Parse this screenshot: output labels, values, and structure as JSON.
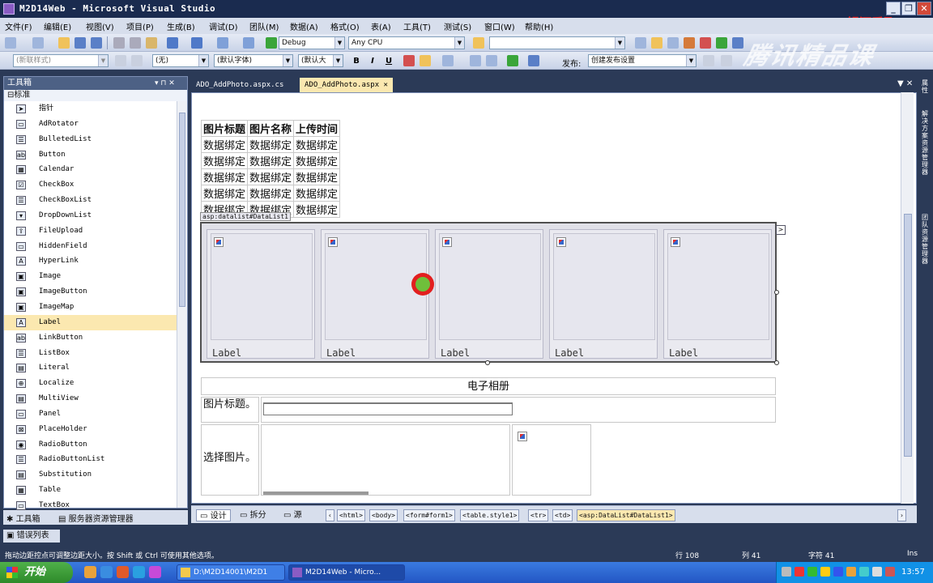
{
  "window": {
    "title": "M2D14Web - Microsoft Visual Studio",
    "brand": "银河爱飞",
    "watermark": "腾讯精品课"
  },
  "menu": [
    "文件(F)",
    "编辑(E)",
    "视图(V)",
    "项目(P)",
    "生成(B)",
    "调试(D)",
    "团队(M)",
    "数据(A)",
    "格式(O)",
    "表(A)",
    "工具(T)",
    "测试(S)",
    "窗口(W)",
    "帮助(H)"
  ],
  "toolbar1": {
    "config": "Debug",
    "platform": "Any CPU"
  },
  "toolbar2": {
    "css_style": "(新联样式)",
    "block_format": "(无)",
    "font_name": "(默认字体)",
    "font_size": "(默认大",
    "publish_label": "发布:",
    "publish_setting": "创建发布设置",
    "bold": "B",
    "italic": "I",
    "underline": "U"
  },
  "toolbox": {
    "header": "工具箱",
    "header_controls": "▾ ⊓ ✕",
    "group": "⊟标准",
    "items": [
      {
        "label": "指针",
        "icon": "➤"
      },
      {
        "label": "AdRotator",
        "icon": "▭"
      },
      {
        "label": "BulletedList",
        "icon": "☰"
      },
      {
        "label": "Button",
        "icon": "ab"
      },
      {
        "label": "Calendar",
        "icon": "▦"
      },
      {
        "label": "CheckBox",
        "icon": "☑"
      },
      {
        "label": "CheckBoxList",
        "icon": "☰"
      },
      {
        "label": "DropDownList",
        "icon": "▾"
      },
      {
        "label": "FileUpload",
        "icon": "⇪"
      },
      {
        "label": "HiddenField",
        "icon": "▭"
      },
      {
        "label": "HyperLink",
        "icon": "A"
      },
      {
        "label": "Image",
        "icon": "▣"
      },
      {
        "label": "ImageButton",
        "icon": "▣"
      },
      {
        "label": "ImageMap",
        "icon": "▣"
      },
      {
        "label": "Label",
        "icon": "A"
      },
      {
        "label": "LinkButton",
        "icon": "ab"
      },
      {
        "label": "ListBox",
        "icon": "☰"
      },
      {
        "label": "Literal",
        "icon": "▤"
      },
      {
        "label": "Localize",
        "icon": "⊕"
      },
      {
        "label": "MultiView",
        "icon": "▤"
      },
      {
        "label": "Panel",
        "icon": "▭"
      },
      {
        "label": "PlaceHolder",
        "icon": "⊠"
      },
      {
        "label": "RadioButton",
        "icon": "◉"
      },
      {
        "label": "RadioButtonList",
        "icon": "☰"
      },
      {
        "label": "Substitution",
        "icon": "▤"
      },
      {
        "label": "Table",
        "icon": "▦"
      },
      {
        "label": "TextBox",
        "icon": "▭"
      }
    ],
    "selected": "Label"
  },
  "bottom_tabs": {
    "toolbox": "工具箱",
    "server_explorer": "服务器资源管理器",
    "error_list": "错误列表"
  },
  "doc_tabs": [
    {
      "label": "ADO_AddPhoto.aspx.cs",
      "active": false
    },
    {
      "label": "ADO_AddPhoto.aspx",
      "active": true
    }
  ],
  "gridview": {
    "headers": [
      "图片标题",
      "图片名称",
      "上传时间"
    ],
    "rows": [
      [
        "数据绑定",
        "数据绑定",
        "数据绑定"
      ],
      [
        "数据绑定",
        "数据绑定",
        "数据绑定"
      ],
      [
        "数据绑定",
        "数据绑定",
        "数据绑定"
      ],
      [
        "数据绑定",
        "数据绑定",
        "数据绑定"
      ],
      [
        "数据绑定",
        "数据绑定",
        "数据绑定"
      ]
    ]
  },
  "datalist": {
    "badge": "asp:datalist#DataList1",
    "items": [
      "Label",
      "Label",
      "Label",
      "Label",
      "Label"
    ],
    "smart_tag": ">"
  },
  "album": {
    "caption": "电子相册",
    "title_label": "图片标题。",
    "choose_label": "选择图片。"
  },
  "view_bar": {
    "design": "设计",
    "split": "拆分",
    "source": "源",
    "crumbs": [
      "<html>",
      "<body>",
      "<form#form1>",
      "<table.style1>",
      "<tr>",
      "<td>",
      "<asp:DataList#DataList1>"
    ]
  },
  "right_dock": [
    "属性",
    "解决方案资源管理器",
    "团队资源管理器"
  ],
  "status": {
    "message": "拖动边距控点可调整边距大小。按 Shift 或 Ctrl 可使用其他选项。",
    "line": "行 108",
    "col": "列 41",
    "char": "字符 41",
    "mode": "Ins"
  },
  "taskbar": {
    "start": "开始",
    "buttons": [
      {
        "label": "D:\\M2D14001\\M2D1",
        "active": false
      },
      {
        "label": "M2D14Web - Micro...",
        "active": true
      }
    ],
    "clock": "13:57"
  }
}
